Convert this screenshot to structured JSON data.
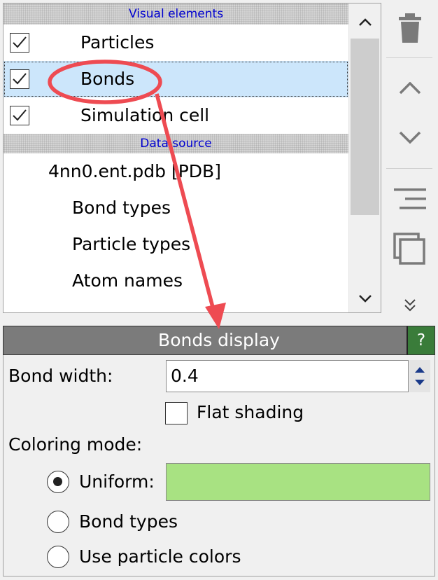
{
  "pipeline": {
    "visual_section_title": "Visual elements",
    "visual_items": [
      {
        "label": "Particles",
        "checked": true
      },
      {
        "label": "Bonds",
        "checked": true,
        "selected": true
      },
      {
        "label": "Simulation cell",
        "checked": true
      }
    ],
    "data_section_title": "Data source",
    "data_items": [
      {
        "label": "4nn0.ent.pdb  [PDB]",
        "indent": 0
      },
      {
        "label": "Bond types",
        "indent": 1
      },
      {
        "label": "Particle types",
        "indent": 1
      },
      {
        "label": "Atom names",
        "indent": 1
      }
    ]
  },
  "toolbar": {
    "icons": [
      "trash-icon",
      "chevron-up-icon",
      "chevron-down-icon",
      "align-right-icon",
      "copy-icon",
      "double-chevron-down-icon"
    ]
  },
  "panel": {
    "title": "Bonds display",
    "help_label": "?",
    "bond_width_label": "Bond width:",
    "bond_width_value": "0.4",
    "flat_shading_label": "Flat shading",
    "flat_shading_checked": false,
    "coloring_mode_label": "Coloring mode:",
    "modes": [
      {
        "label": "Uniform:",
        "selected": true
      },
      {
        "label": "Bond types",
        "selected": false
      },
      {
        "label": "Use particle colors",
        "selected": false
      }
    ],
    "uniform_color": "#a8e282"
  },
  "annotation": {
    "color": "#ee4b52"
  }
}
